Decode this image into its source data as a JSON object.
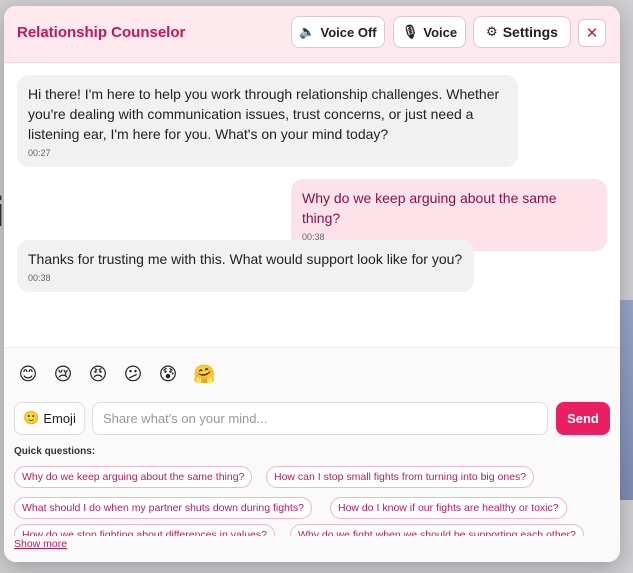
{
  "header": {
    "title": "Relationship Counselor",
    "voice_off_label": "Voice Off",
    "voice_label": "Voice",
    "settings_label": "Settings",
    "close_symbol": "✕"
  },
  "icons": {
    "voice_off": "speaker-off-icon",
    "voice": "microphone-icon",
    "settings": "gear-icon",
    "emoji": "smiley-icon"
  },
  "messages": [
    {
      "role": "bot",
      "text": "Hi there! I'm here to help you work through relationship challenges. Whether you're dealing with communication issues, trust concerns, or just need a listening ear, I'm here for you. What's on your mind today?",
      "time": "00:27"
    },
    {
      "role": "user",
      "text": "Why do we keep arguing about the same thing?",
      "time": "00:38"
    },
    {
      "role": "bot",
      "text": "Thanks for trusting me with this. What would support look like for you?",
      "time": "00:38"
    }
  ],
  "emojis": [
    "😊",
    "😢",
    "😠",
    "😕",
    "😰",
    "🤗"
  ],
  "composer": {
    "emoji_label": "Emoji",
    "emoji_glyph": "🙂",
    "placeholder": "Share what's on your mind...",
    "value": "",
    "send_label": "Send"
  },
  "quick_questions": {
    "label": "Quick questions:",
    "items": [
      "Why do we keep arguing about the same thing?",
      "How can I stop small fights from turning into big ones?",
      "What should I do when my partner shuts down during fights?",
      "How do I know if our fights are healthy or toxic?",
      "How do we stop fighting about differences in values?",
      "Why do we fight when we should be supporting each other?"
    ],
    "show_more_label": "Show more"
  },
  "colors": {
    "accent": "#e91e63",
    "accent_text": "#c2185b",
    "header_bg": "#fde8ee",
    "user_bubble": "#fde2ea",
    "bot_bubble": "#f1f1f1"
  }
}
